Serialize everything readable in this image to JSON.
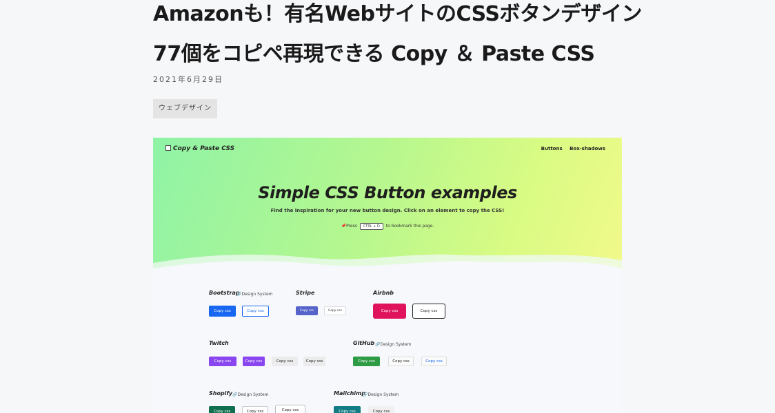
{
  "article": {
    "title_line1": "Amazonも！有名WebサイトのCSSボタンデザイン",
    "title_line2": "77個をコピペ再現できる Copy ＆ Paste CSS",
    "date": "2021年6月29日",
    "category": "ウェブデザイン"
  },
  "preview": {
    "logo": "Copy & Paste CSS",
    "nav": [
      "Buttons",
      "Box-shadows"
    ],
    "heading": "Simple CSS Button examples",
    "subheading": "Find the inspiration for your new button design. Click on an element to copy the CSS!",
    "press_prefix": "Press",
    "shortcut": "CTRL + D",
    "press_suffix": "to bookmark this page.",
    "design_system": "Design System",
    "button_label": "Copy css",
    "brands": [
      "Bootstrap",
      "Stripe",
      "Airbnb",
      "Twitch",
      "GitHub",
      "Shopify",
      "Mailchimp"
    ],
    "colors": {
      "bootstrap": "#1767f2",
      "stripe": "#5664c9",
      "airbnb": "#e0125b",
      "twitch": "#8a46f0",
      "github": "#2e9b45",
      "shopify": "#106f4e",
      "mailchimp": "#117c83"
    }
  }
}
